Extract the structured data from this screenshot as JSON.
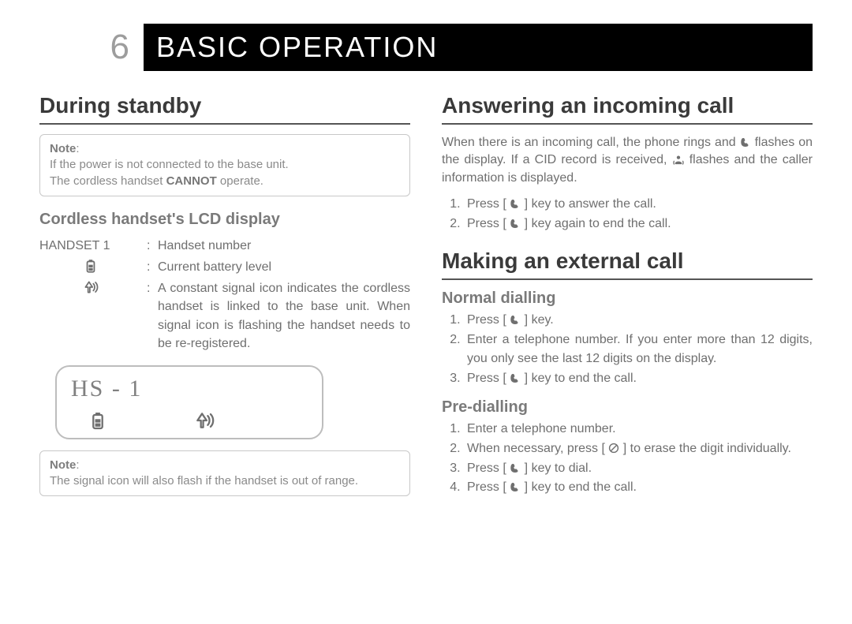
{
  "header": {
    "chapter_number": "6",
    "title": "BASIC OPERATION"
  },
  "left": {
    "h2": "During standby",
    "note1": {
      "label": "Note",
      "line1": "If the power is not connected to the base unit.",
      "line2_a": "The cordless handset ",
      "line2_strong": "CANNOT",
      "line2_b": " operate."
    },
    "h3": "Cordless handset's LCD display",
    "def": {
      "k1": "HANDSET 1",
      "v1": "Handset number",
      "v2": "Current battery level",
      "v3": "A constant signal icon indicates the cordless handset is linked to the base unit. When signal icon is flashing the handset needs to be re-registered."
    },
    "lcd_text": "HS - 1",
    "note2": {
      "label": "Note",
      "text": "The signal icon will also flash if the handset is out of range."
    }
  },
  "right": {
    "s1": {
      "h2": "Answering an incoming call",
      "para_a": "When there is an incoming call, the phone rings and ",
      "para_b": " flashes on the display. If a CID record is received, ",
      "para_c": " flashes and the caller information is displayed.",
      "li1_a": "Press [ ",
      "li1_b": " ] key to answer the call.",
      "li2_a": "Press [ ",
      "li2_b": " ] key again to end the call."
    },
    "s2": {
      "h2": "Making an external call",
      "sub1": {
        "h3": "Normal dialling",
        "li1_a": "Press [ ",
        "li1_b": " ] key.",
        "li2": "Enter a telephone number. If you enter more than 12 digits, you only see the last 12 digits on the display.",
        "li3_a": "Press [ ",
        "li3_b": " ] key to end the call."
      },
      "sub2": {
        "h3": "Pre-dialling",
        "li1": "Enter a telephone number.",
        "li2_a": "When necessary, press [ ",
        "li2_b": " ] to erase the digit individually.",
        "li3_a": "Press [ ",
        "li3_b": " ] key to dial.",
        "li4_a": "Press [ ",
        "li4_b": " ] key to end the call."
      }
    }
  }
}
